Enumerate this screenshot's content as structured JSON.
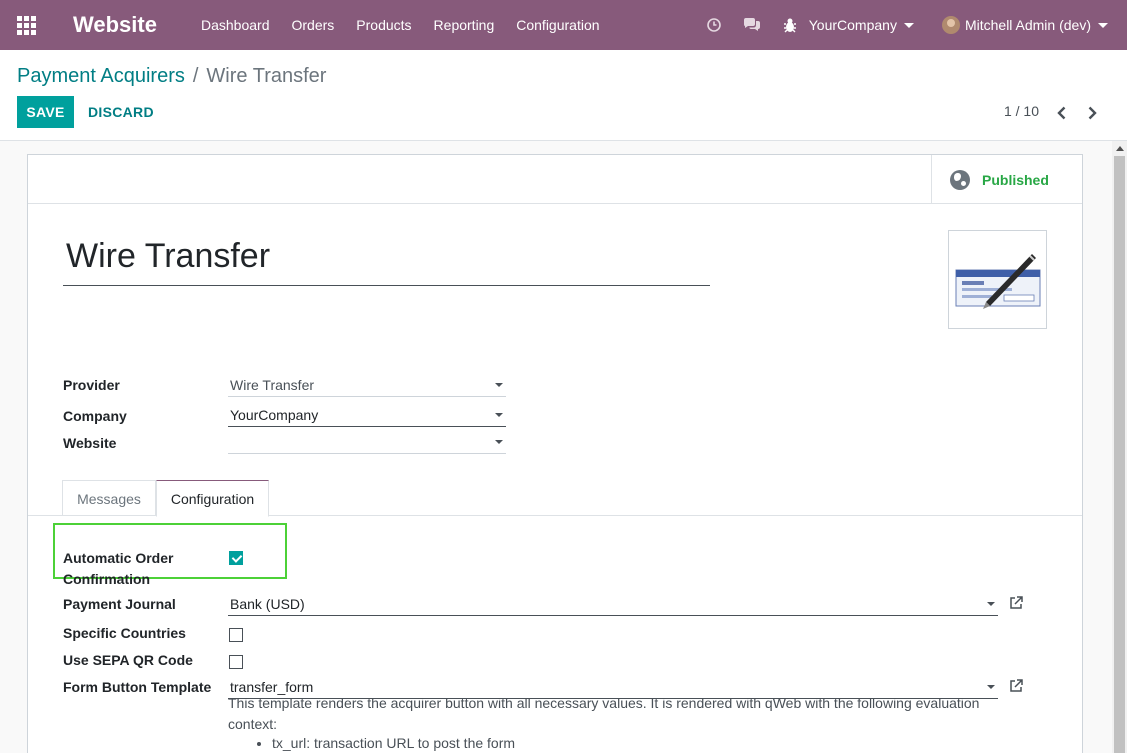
{
  "navbar": {
    "app_name": "Website",
    "menu": [
      "Dashboard",
      "Orders",
      "Products",
      "Reporting",
      "Configuration"
    ],
    "company": "YourCompany",
    "user": "Mitchell Admin (dev)"
  },
  "breadcrumb": {
    "parent": "Payment Acquirers",
    "separator": "/",
    "current": "Wire Transfer"
  },
  "buttons": {
    "save": "SAVE",
    "discard": "DISCARD"
  },
  "pager": {
    "value": "1 / 10"
  },
  "status": {
    "published": "Published"
  },
  "form": {
    "name": "Wire Transfer",
    "provider_label": "Provider",
    "provider_value": "Wire Transfer",
    "company_label": "Company",
    "company_value": "YourCompany",
    "website_label": "Website",
    "website_value": ""
  },
  "tabs": {
    "messages": "Messages",
    "configuration": "Configuration"
  },
  "config": {
    "auto_confirm_label": "Automatic Order Confirmation",
    "auto_confirm_checked": true,
    "journal_label": "Payment Journal",
    "journal_value": "Bank (USD)",
    "countries_label": "Specific Countries",
    "countries_checked": false,
    "sepa_label": "Use SEPA QR Code",
    "sepa_checked": false,
    "template_label": "Form Button Template",
    "template_value": "transfer_form",
    "help_text": "This template renders the acquirer button with all necessary values. It is rendered with qWeb with the following evaluation context:",
    "help_items": [
      "tx_url: transaction URL to post the form"
    ]
  },
  "colors": {
    "navbar": "#875a7b",
    "primary": "#00a09d",
    "link": "#017e84",
    "published": "#28a745",
    "highlight": "#4cd137"
  }
}
